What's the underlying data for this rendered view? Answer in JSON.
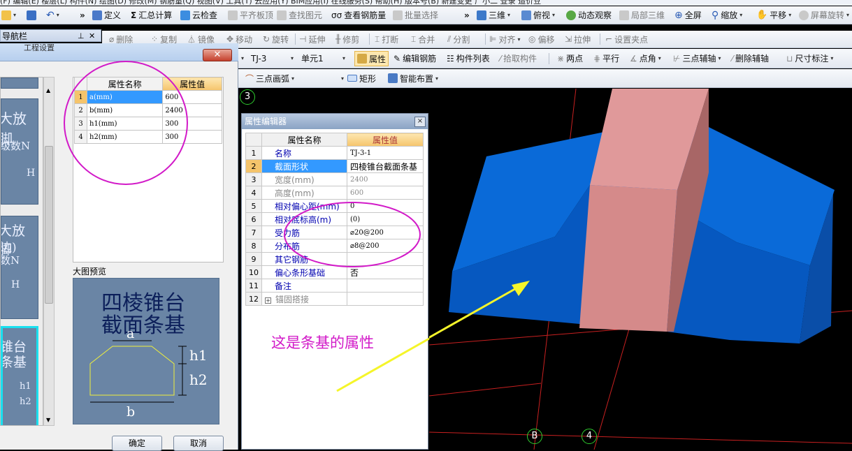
{
  "menubar": {
    "text": "(F)  编辑(E)  楼层(L)  构件(N)  绘图(D)  修改(M)  钢筋量(Q)  视图(V)  工具(T)  云应用(Y)  BIM应用(I)  在线服务(S)  帮助(H)  版本号(B)    新建变更      广小二                                  登录  造价豆"
  },
  "toolbar1": {
    "items": [
      "定义",
      "汇总计算",
      "云检查",
      "平齐板顶",
      "查找图元",
      "查看钢筋量",
      "批量选择",
      "三维",
      "俯视",
      "动态观察",
      "局部三维",
      "全屏",
      "缩放",
      "平移",
      "屏幕旋转"
    ]
  },
  "nav_title": "导航栏",
  "toolbar2": {
    "items": [
      "删除",
      "复制",
      "镜像",
      "移动",
      "旋转",
      "延伸",
      "修剪",
      "打断",
      "合并",
      "分割",
      "对齐",
      "偏移",
      "拉伸",
      "设置夹点"
    ]
  },
  "toolbar3": {
    "element_select": "TJ-3",
    "unit_select": "单元1",
    "items": [
      "属性",
      "编辑钢筋",
      "构件列表",
      "拾取构件",
      "两点",
      "平行",
      "点角",
      "三点辅轴",
      "删除辅轴",
      "尺寸标注"
    ]
  },
  "toolbar4": {
    "items": [
      "三点画弧",
      "矩形",
      "智能布置"
    ]
  },
  "dialog": {
    "partial_title": "工程设置",
    "close": "✕",
    "param_table": {
      "headers": [
        "属性名称",
        "属性值"
      ],
      "rows": [
        {
          "n": "1",
          "name": "a(mm)",
          "value": "600"
        },
        {
          "n": "2",
          "name": "b(mm)",
          "value": "2400"
        },
        {
          "n": "3",
          "name": "h1(mm)",
          "value": "300"
        },
        {
          "n": "4",
          "name": "h2(mm)",
          "value": "300"
        }
      ]
    },
    "thumbs": [
      {
        "line1": "大放脚",
        "line2": "级数N",
        "line3": "H"
      },
      {
        "line1": "大放脚",
        "line2": "边)",
        "line3": "数N",
        "line4": "H"
      },
      {
        "line1": "锥台",
        "line2": "条基",
        "line3": "h1",
        "line4": "h2"
      }
    ],
    "preview_label": "大图预览",
    "preview": {
      "title1": "四棱锥台",
      "title2": "截面条基",
      "a": "a",
      "b": "b",
      "h1": "h1",
      "h2": "h2"
    },
    "ok": "确定",
    "cancel": "取消"
  },
  "property_editor": {
    "title": "属性编辑器",
    "close": "×",
    "headers": [
      "属性名称",
      "属性值"
    ],
    "rows": [
      {
        "n": "1",
        "name": "名称",
        "value": "TJ-3-1"
      },
      {
        "n": "2",
        "name": "截面形状",
        "value": "四棱锥台截面条基"
      },
      {
        "n": "3",
        "name": "宽度(mm)",
        "value": "2400"
      },
      {
        "n": "4",
        "name": "高度(mm)",
        "value": "600"
      },
      {
        "n": "5",
        "name": "相对偏心距(mm)",
        "value": "0"
      },
      {
        "n": "6",
        "name": "相对底标高(m)",
        "value": "(0)"
      },
      {
        "n": "7",
        "name": "受力筋",
        "value": "⌀20@200"
      },
      {
        "n": "8",
        "name": "分布筋",
        "value": "⌀8@200"
      },
      {
        "n": "9",
        "name": "其它钢筋",
        "value": ""
      },
      {
        "n": "10",
        "name": "偏心条形基础",
        "value": "否"
      },
      {
        "n": "11",
        "name": "备注",
        "value": ""
      },
      {
        "n": "12",
        "name": "锚固搭接",
        "value": ""
      }
    ]
  },
  "annotation": "这是条基的属性",
  "axis_labels": {
    "top": "3",
    "bottom_left": "B",
    "bottom_right": "4"
  },
  "colors": {
    "magenta": "#d21ac8",
    "blue_block": "#0a6ad8",
    "pink_column": "#d88f8f",
    "yellow_arrow": "#f5f52a"
  }
}
